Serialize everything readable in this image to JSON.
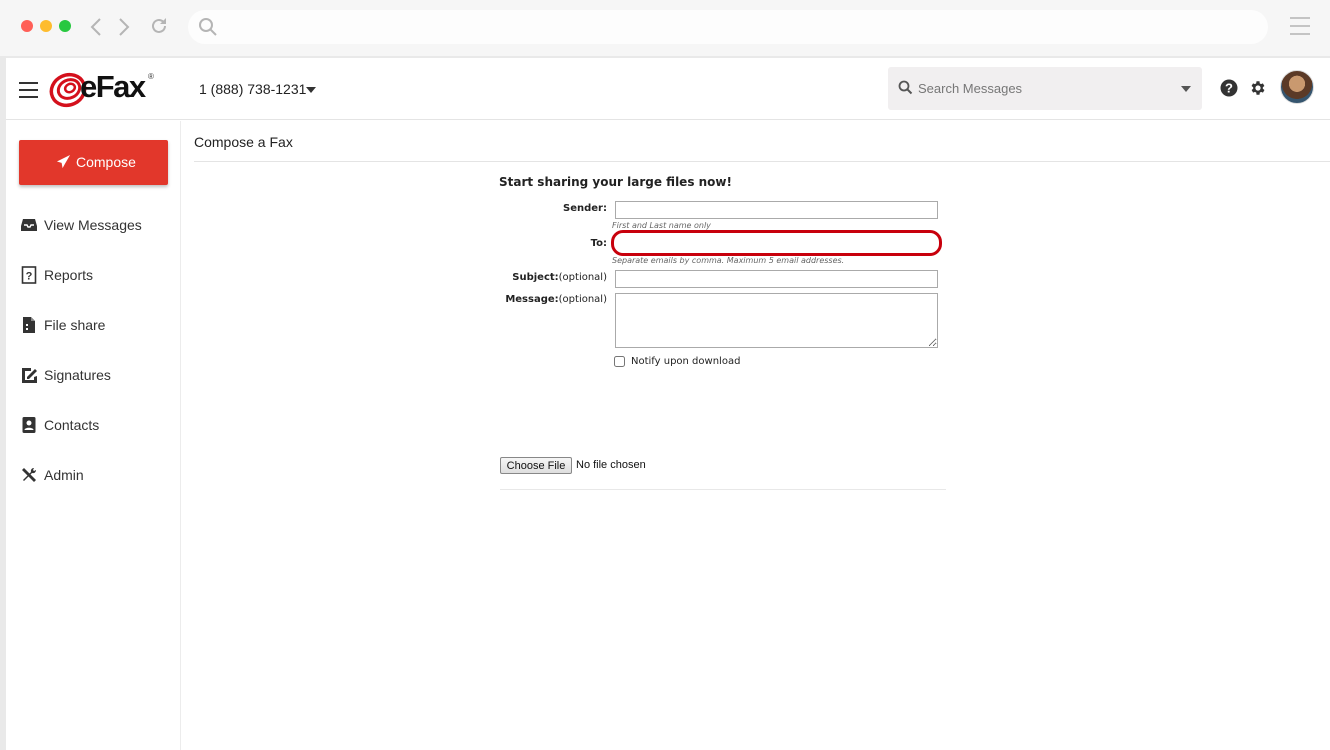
{
  "colors": {
    "accent": "#e2372b",
    "highlight_ring": "#c8000c"
  },
  "browser": {
    "back_icon": "chevron-left-icon",
    "forward_icon": "chevron-right-icon",
    "reload_icon": "reload-icon",
    "search_icon": "search-icon",
    "menu_icon": "hamburger-icon"
  },
  "header": {
    "logo_text": "eFax",
    "phone_number": "1 (888) 738-1231",
    "search_placeholder": "Search Messages",
    "help_icon": "question-circle-icon",
    "settings_icon": "gear-icon"
  },
  "sidebar": {
    "compose_label": "Compose",
    "items": [
      {
        "label": "View Messages",
        "icon": "inbox-icon"
      },
      {
        "label": "Reports",
        "icon": "report-icon"
      },
      {
        "label": "File share",
        "icon": "file-icon"
      },
      {
        "label": "Signatures",
        "icon": "signature-icon"
      },
      {
        "label": "Contacts",
        "icon": "contacts-icon"
      },
      {
        "label": "Admin",
        "icon": "tools-icon"
      }
    ]
  },
  "main": {
    "page_title": "Compose a Fax",
    "form": {
      "heading": "Start sharing your large files now!",
      "sender_label": "Sender:",
      "sender_value": "",
      "sender_hint": "First and Last name only",
      "to_label": "To:",
      "to_value": "",
      "to_hint": "Separate emails by comma. Maximum 5 email addresses.",
      "subject_label": "Subject:",
      "subject_suffix": "(optional)",
      "subject_value": "",
      "message_label": "Message:",
      "message_suffix": "(optional)",
      "message_value": "",
      "notify_label": "Notify upon download",
      "notify_checked": false,
      "choose_file_label": "Choose File",
      "file_status": "No file chosen"
    }
  }
}
